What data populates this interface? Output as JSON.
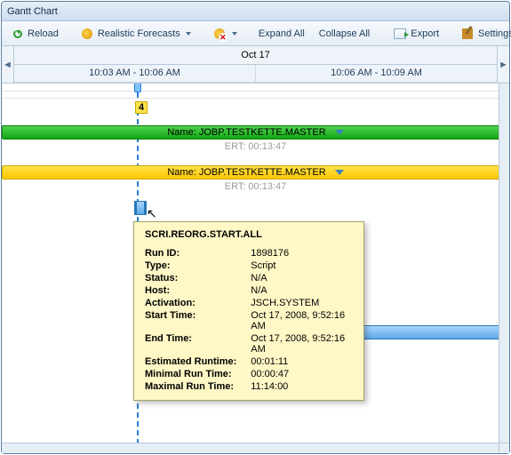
{
  "title": "Gantt Chart",
  "toolbar": {
    "reload": "Reload",
    "forecasts": "Realistic Forecasts",
    "expand": "Expand All",
    "collapse": "Collapse All",
    "export": "Export",
    "settings": "Settings"
  },
  "timeline": {
    "day": "Oct 17",
    "range1": "10:03 AM - 10:06 AM",
    "range2": "10:06 AM - 10:09 AM"
  },
  "badge": "4",
  "bars": {
    "green_label": "Name: JOBP.TESTKETTE.MASTER",
    "green_ert": "ERT: 00:13:47",
    "yellow_label": "Name: JOBP.TESTKETTE.MASTER",
    "yellow_ert": "ERT: 00:13:47"
  },
  "tooltip": {
    "title": "SCRI.REORG.START.ALL",
    "rows": [
      {
        "k": "Run ID:",
        "v": "1898176"
      },
      {
        "k": "Type:",
        "v": "Script"
      },
      {
        "k": "Status:",
        "v": "N/A"
      },
      {
        "k": "Host:",
        "v": "N/A"
      },
      {
        "k": "Activation:",
        "v": "JSCH.SYSTEM"
      },
      {
        "k": "Start Time:",
        "v": "Oct 17, 2008, 9:52:16 AM"
      },
      {
        "k": "End Time:",
        "v": "Oct 17, 2008, 9:52:16 AM"
      },
      {
        "k": "Estimated Runtime:",
        "v": "00:01:11"
      },
      {
        "k": "Minimal Run Time:",
        "v": "00:00:47"
      },
      {
        "k": "Maximal Run Time:",
        "v": "11:14:00"
      }
    ]
  }
}
